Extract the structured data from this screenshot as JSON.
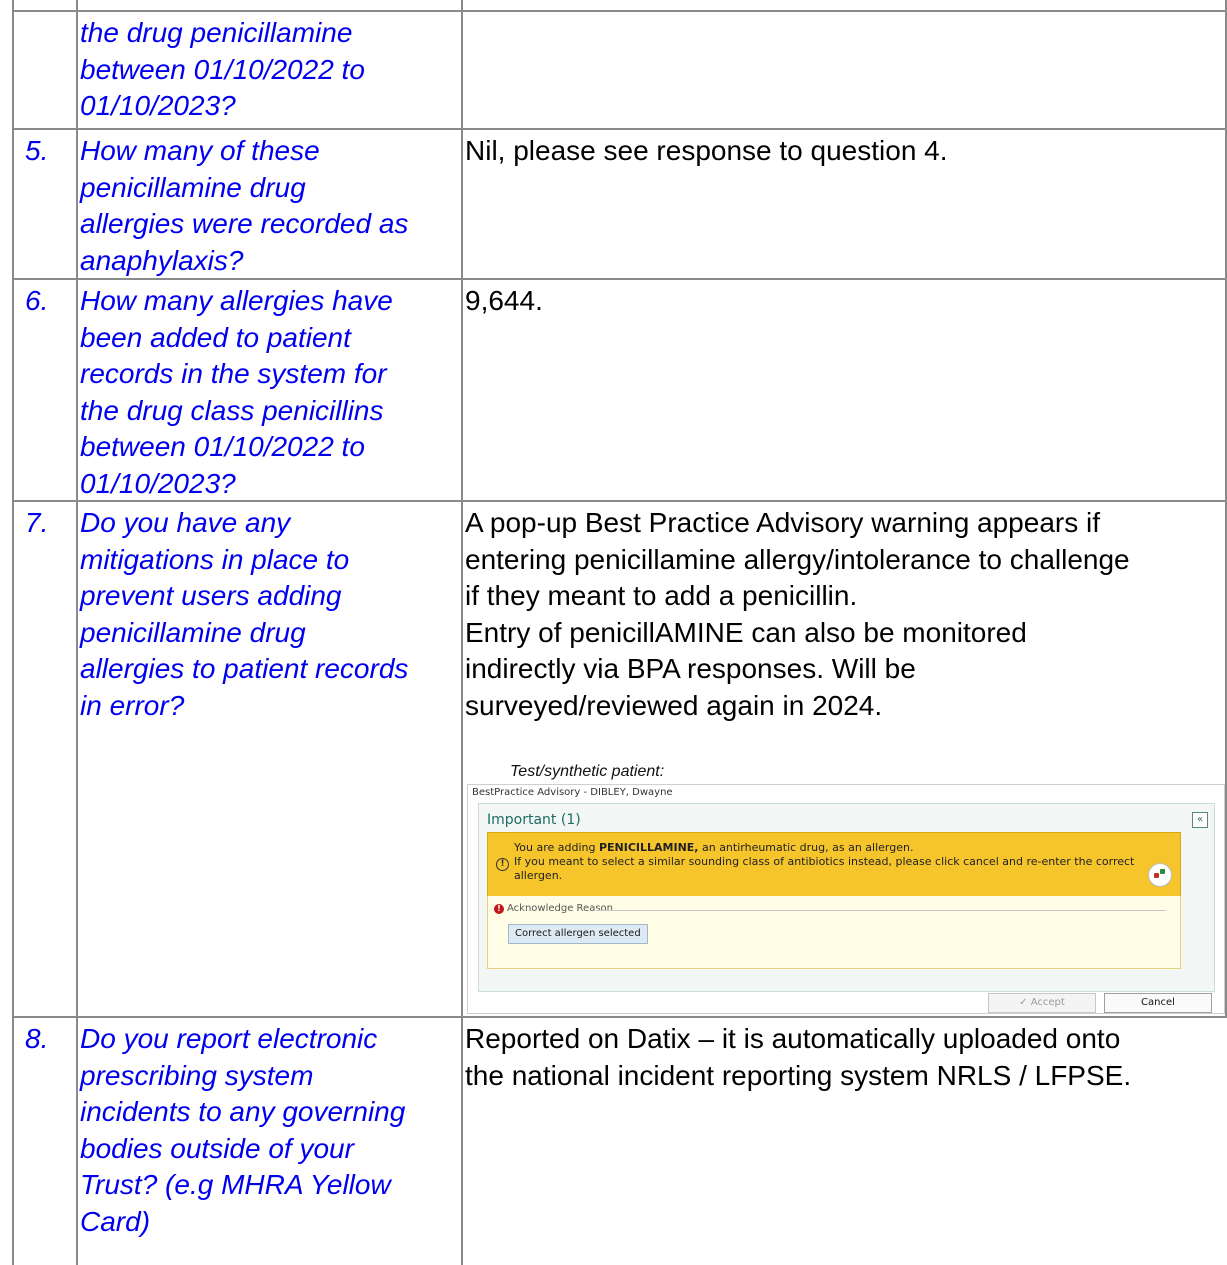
{
  "rows": [
    {
      "number": "",
      "question_lines": [
        "the drug penicillamine",
        "between 01/10/2022 to",
        "01/10/2023?"
      ],
      "answer_lines": []
    },
    {
      "number": "5.",
      "question_lines": [
        "How many of these",
        "penicillamine drug",
        "allergies were recorded as",
        "anaphylaxis?"
      ],
      "answer_lines": [
        "Nil, please see response to question 4."
      ]
    },
    {
      "number": "6.",
      "question_lines": [
        "How many allergies have",
        "been added to patient",
        "records in the system for",
        "the drug class penicillins",
        "between 01/10/2022 to",
        "01/10/2023?"
      ],
      "answer_lines": [
        "9,644."
      ]
    },
    {
      "number": "7.",
      "question_lines": [
        "Do you have any",
        "mitigations in place to",
        "prevent users adding",
        "penicillamine drug",
        "allergies to patient records",
        "in error?"
      ],
      "answer_lines": [
        "A pop-up Best Practice Advisory warning appears if",
        "entering penicillamine allergy/intolerance to challenge",
        "if they meant to add a penicillin.",
        "Entry of penicillAMINE can also be monitored",
        "indirectly via BPA responses. Will be",
        "surveyed/reviewed again in 2024."
      ]
    },
    {
      "number": "8.",
      "question_lines": [
        "Do you report electronic",
        "prescribing system",
        "incidents to any governing",
        "bodies outside of your",
        "Trust? (e.g MHRA Yellow",
        "Card)"
      ],
      "answer_lines": [
        "Reported on Datix – it is automatically uploaded onto",
        "the national incident reporting system NRLS / LFPSE."
      ]
    }
  ],
  "screenshot": {
    "caption": "Test/synthetic patient:",
    "window_title": "BestPractice Advisory - DIBLEY, Dwayne",
    "section_label": "Important (1)",
    "collapse_icon": "«",
    "alert_text_prefix": "You are adding ",
    "alert_drug": "PENICILLAMINE,",
    "alert_text_suffix": " an antirheumatic drug, as an allergen.",
    "alert_line2": "If you meant to select a similar sounding class of antibiotics instead, please click cancel and re-enter the correct",
    "alert_line3": "allergen.",
    "ack_label": "Acknowledge Reason",
    "reason_button": "Correct allergen selected",
    "accept_button": "✓ Accept",
    "cancel_button": "Cancel",
    "colors": {
      "alert": "#f5c52b",
      "heading": "#1f6b60"
    }
  }
}
